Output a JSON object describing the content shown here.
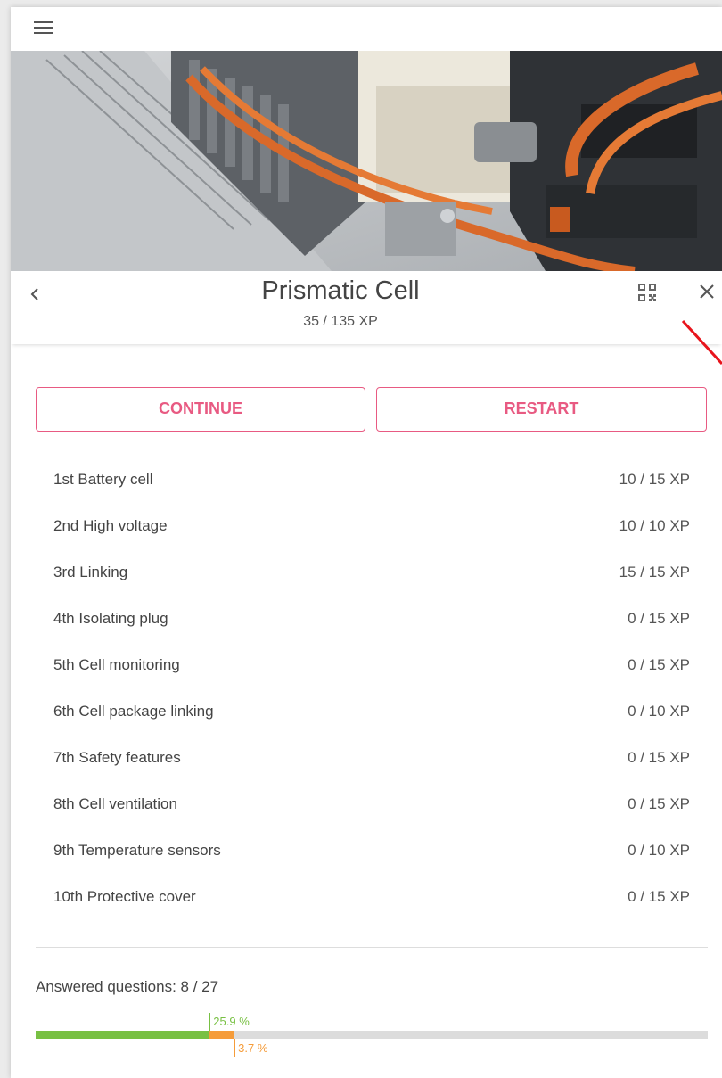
{
  "header": {
    "title": "Prismatic Cell",
    "xp": "35 / 135 XP"
  },
  "icons": {
    "menu": "hamburger-menu-icon",
    "back": "chevron-left-icon",
    "qr": "qr-code-icon",
    "close": "close-icon"
  },
  "actions": {
    "continue_label": "CONTINUE",
    "restart_label": "RESTART"
  },
  "chapters": [
    {
      "label": "1st  Battery cell",
      "xp": "10 / 15 XP"
    },
    {
      "label": "2nd  High voltage",
      "xp": "10 / 10 XP"
    },
    {
      "label": "3rd  Linking",
      "xp": "15 / 15 XP"
    },
    {
      "label": "4th  Isolating plug",
      "xp": "0 / 15 XP"
    },
    {
      "label": "5th  Cell monitoring",
      "xp": "0 / 15 XP"
    },
    {
      "label": "6th  Cell package linking",
      "xp": "0 / 10 XP"
    },
    {
      "label": "7th  Safety features",
      "xp": "0 / 15 XP"
    },
    {
      "label": "8th  Cell ventilation",
      "xp": "0 / 15 XP"
    },
    {
      "label": "9th  Temperature sensors",
      "xp": "0 / 10 XP"
    },
    {
      "label": "10th  Protective cover",
      "xp": "0 / 15 XP"
    }
  ],
  "progress": {
    "answered_label": "Answered questions: 8 / 27",
    "correct_pct": 25.9,
    "correct_label": "25.9 %",
    "wrong_pct": 3.7,
    "wrong_label": "3.7 %"
  },
  "colors": {
    "accent": "#e85a82",
    "correct": "#78c043",
    "wrong": "#f59c3a",
    "annotation_arrow": "#e8141c"
  }
}
